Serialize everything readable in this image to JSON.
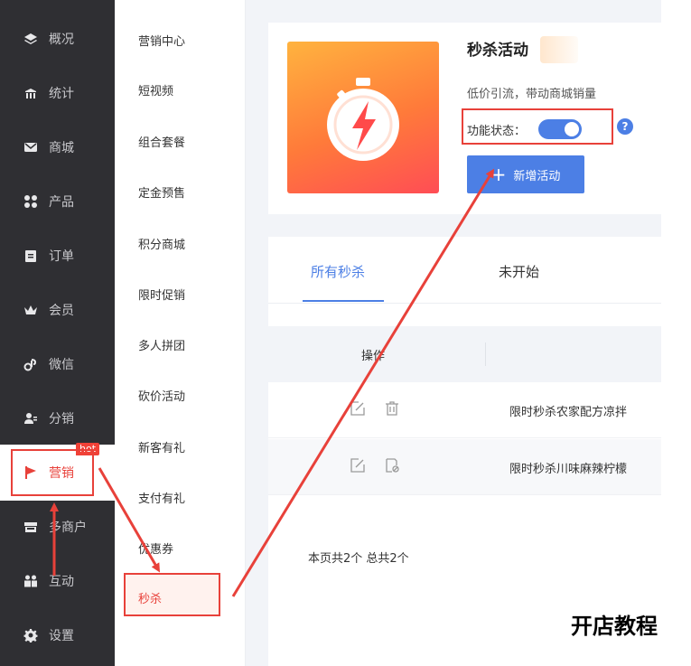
{
  "left_nav": {
    "items": [
      {
        "label": "概况",
        "icon": "layers-icon"
      },
      {
        "label": "统计",
        "icon": "chart-icon"
      },
      {
        "label": "商城",
        "icon": "mail-icon"
      },
      {
        "label": "产品",
        "icon": "grid-icon"
      },
      {
        "label": "订单",
        "icon": "clipboard-icon"
      },
      {
        "label": "会员",
        "icon": "crown-icon"
      },
      {
        "label": "微信",
        "icon": "link-icon"
      },
      {
        "label": "分销",
        "icon": "users-icon"
      },
      {
        "label": "营销",
        "icon": "flag-icon"
      },
      {
        "label": "多商户",
        "icon": "store-icon"
      },
      {
        "label": "互动",
        "icon": "people-icon"
      },
      {
        "label": "设置",
        "icon": "gear-icon"
      }
    ],
    "hot_badge": "hot"
  },
  "sub_nav": {
    "items": [
      "营销中心",
      "短视频",
      "组合套餐",
      "定金预售",
      "积分商城",
      "限时促销",
      "多人拼团",
      "砍价活动",
      "新客有礼",
      "支付有礼",
      "优惠券"
    ],
    "active": "秒杀"
  },
  "activity": {
    "title": "秒杀活动",
    "description": "低价引流，带动商城销量",
    "status_label": "功能状态：",
    "toggle_on": true,
    "help": "?",
    "add_button": "新增活动",
    "add_button_prefix": "+"
  },
  "tabs": [
    "所有秒杀",
    "未开始"
  ],
  "table": {
    "header_ops": "操作",
    "rows": [
      {
        "name": "限时秒杀农家配方凉拌"
      },
      {
        "name": "限时秒杀川味麻辣柠檬"
      }
    ]
  },
  "pagination": "本页共2个  总共2个",
  "watermark": "开店教程",
  "colors": {
    "accent": "#4c7fe5",
    "nav_bg": "#2f2f33",
    "highlight": "#e8413a"
  }
}
